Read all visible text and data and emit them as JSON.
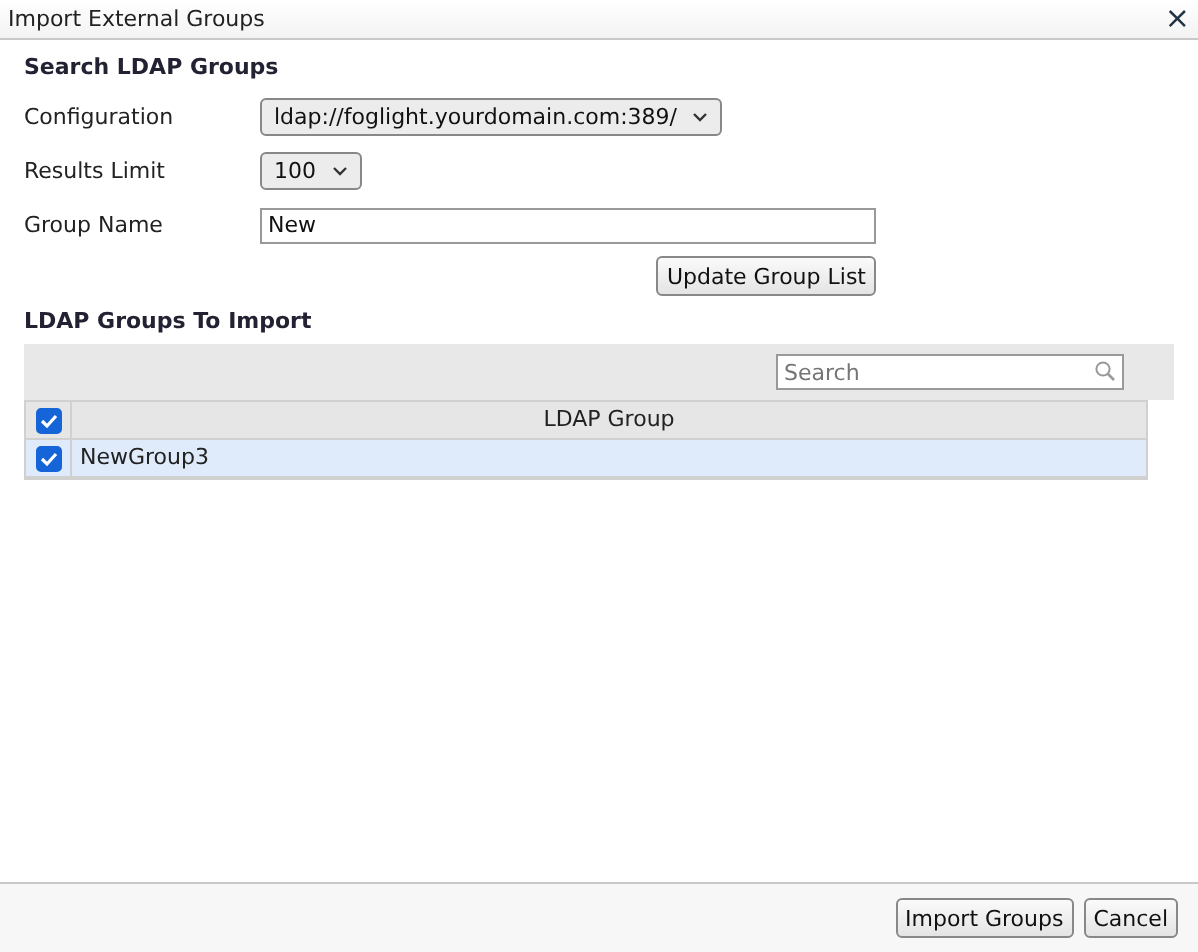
{
  "window": {
    "title": "Import External Groups",
    "close": "×"
  },
  "search_section": {
    "heading": "Search LDAP Groups",
    "configuration": {
      "label": "Configuration",
      "value": "ldap://foglight.yourdomain.com:389/"
    },
    "results_limit": {
      "label": "Results Limit",
      "value": "100"
    },
    "group_name": {
      "label": "Group Name",
      "value": "New"
    },
    "update_button": "Update Group List"
  },
  "import_section": {
    "heading": "LDAP Groups To Import",
    "search": {
      "placeholder": "Search"
    },
    "table": {
      "all_checked": true,
      "columns": [
        "LDAP Group"
      ],
      "rows": [
        {
          "name": "NewGroup3",
          "checked": true,
          "selected": true
        }
      ]
    }
  },
  "buttons": [
    "Import Groups",
    "Cancel"
  ]
}
